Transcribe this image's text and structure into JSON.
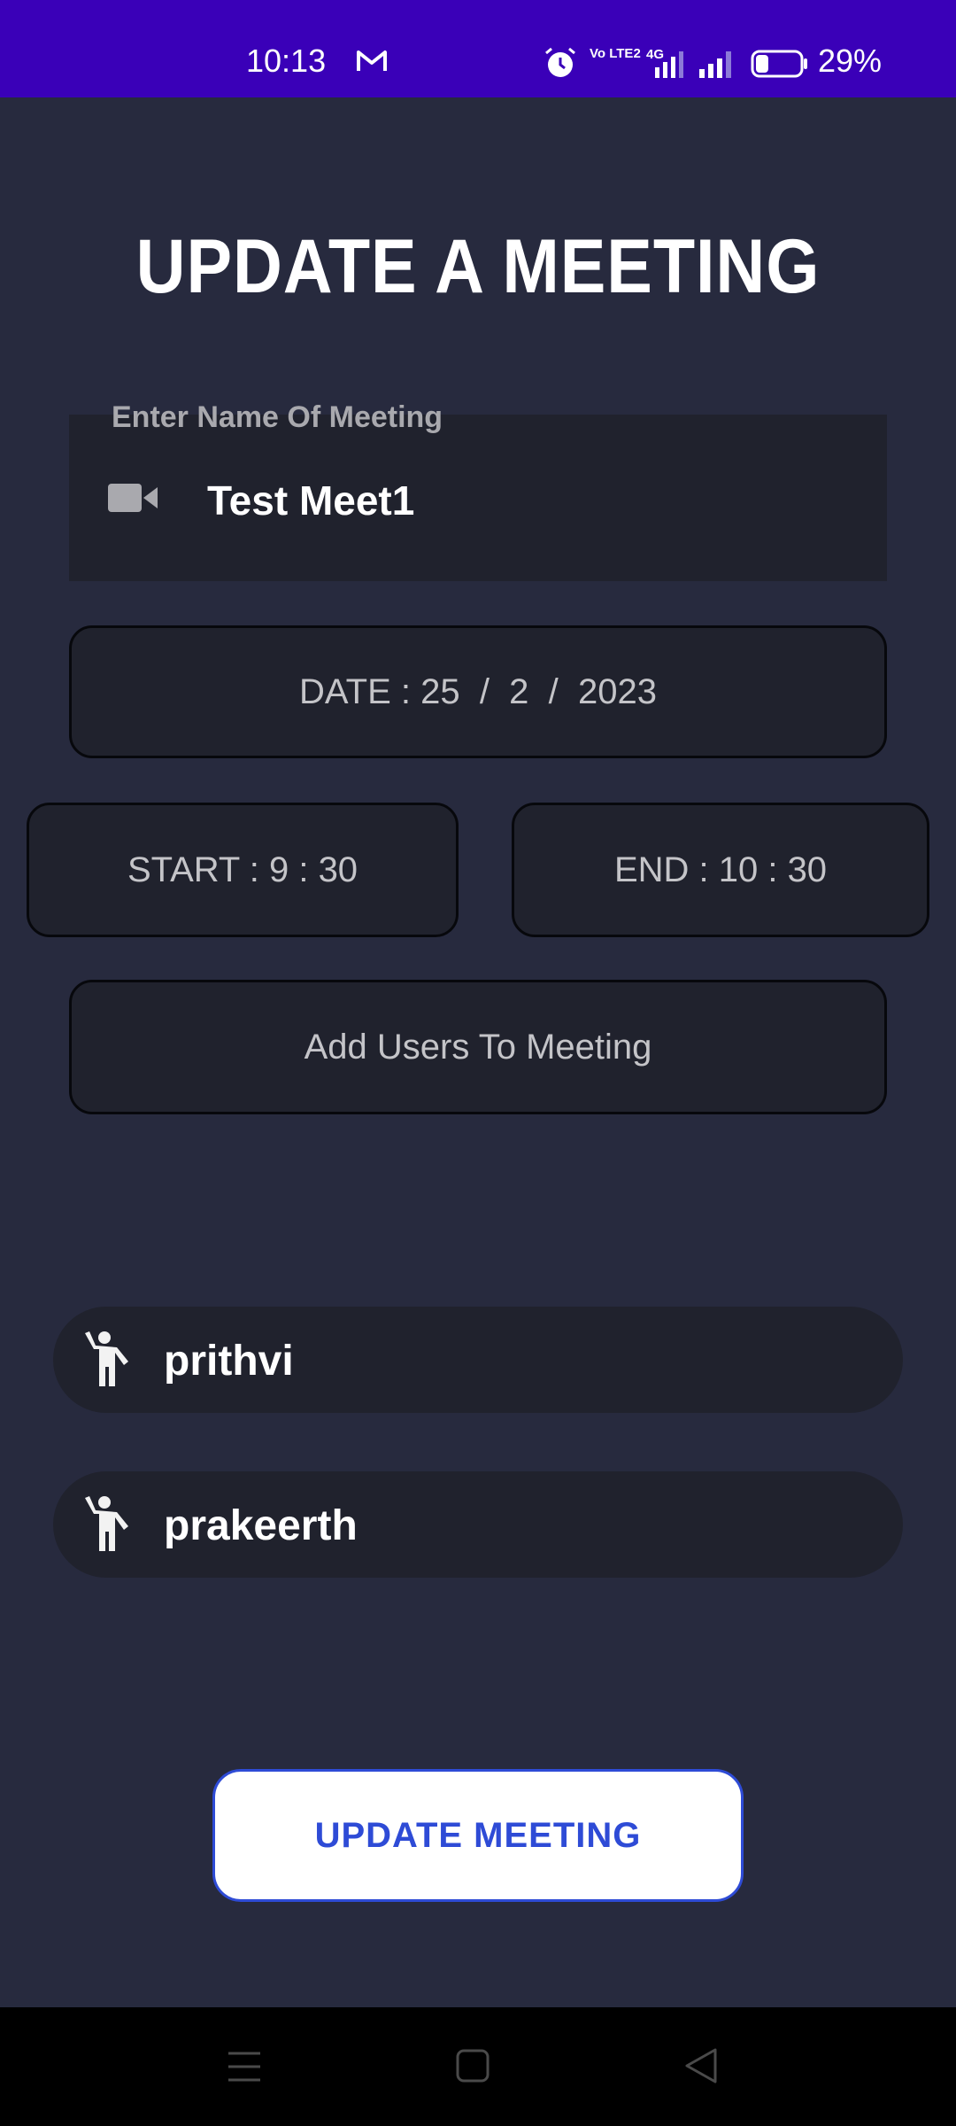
{
  "status_bar": {
    "time": "10:13",
    "network_label": "Vo LTE2",
    "network_type": "4G",
    "battery_percent": "29%",
    "battery_level": 0.29,
    "icons": [
      "gmail-icon",
      "alarm-icon",
      "volte-icon",
      "signal-icon",
      "battery-icon"
    ]
  },
  "page": {
    "title": "UPDATE A MEETING"
  },
  "meeting_name_field": {
    "label": "Enter Name Of Meeting",
    "value": "Test Meet1",
    "icon": "video-camera-icon"
  },
  "date_button": {
    "label": "DATE : 25  /  2  /  2023"
  },
  "start_button": {
    "label": "START : 9 : 30"
  },
  "end_button": {
    "label": "END : 10 : 30"
  },
  "add_users_button": {
    "label": "Add Users To Meeting"
  },
  "users": [
    {
      "name": "prithvi",
      "icon": "person-waving-icon"
    },
    {
      "name": "prakeerth",
      "icon": "person-waving-icon"
    }
  ],
  "update_button": {
    "label": "UPDATE MEETING"
  },
  "nav_bar": {
    "icons": [
      "menu-icon",
      "home-icon",
      "back-icon"
    ]
  },
  "colors": {
    "status_bar": "#3a00b8",
    "background": "#272a3e",
    "field_background": "#20222d",
    "accent_blue": "#2e4bd6"
  }
}
